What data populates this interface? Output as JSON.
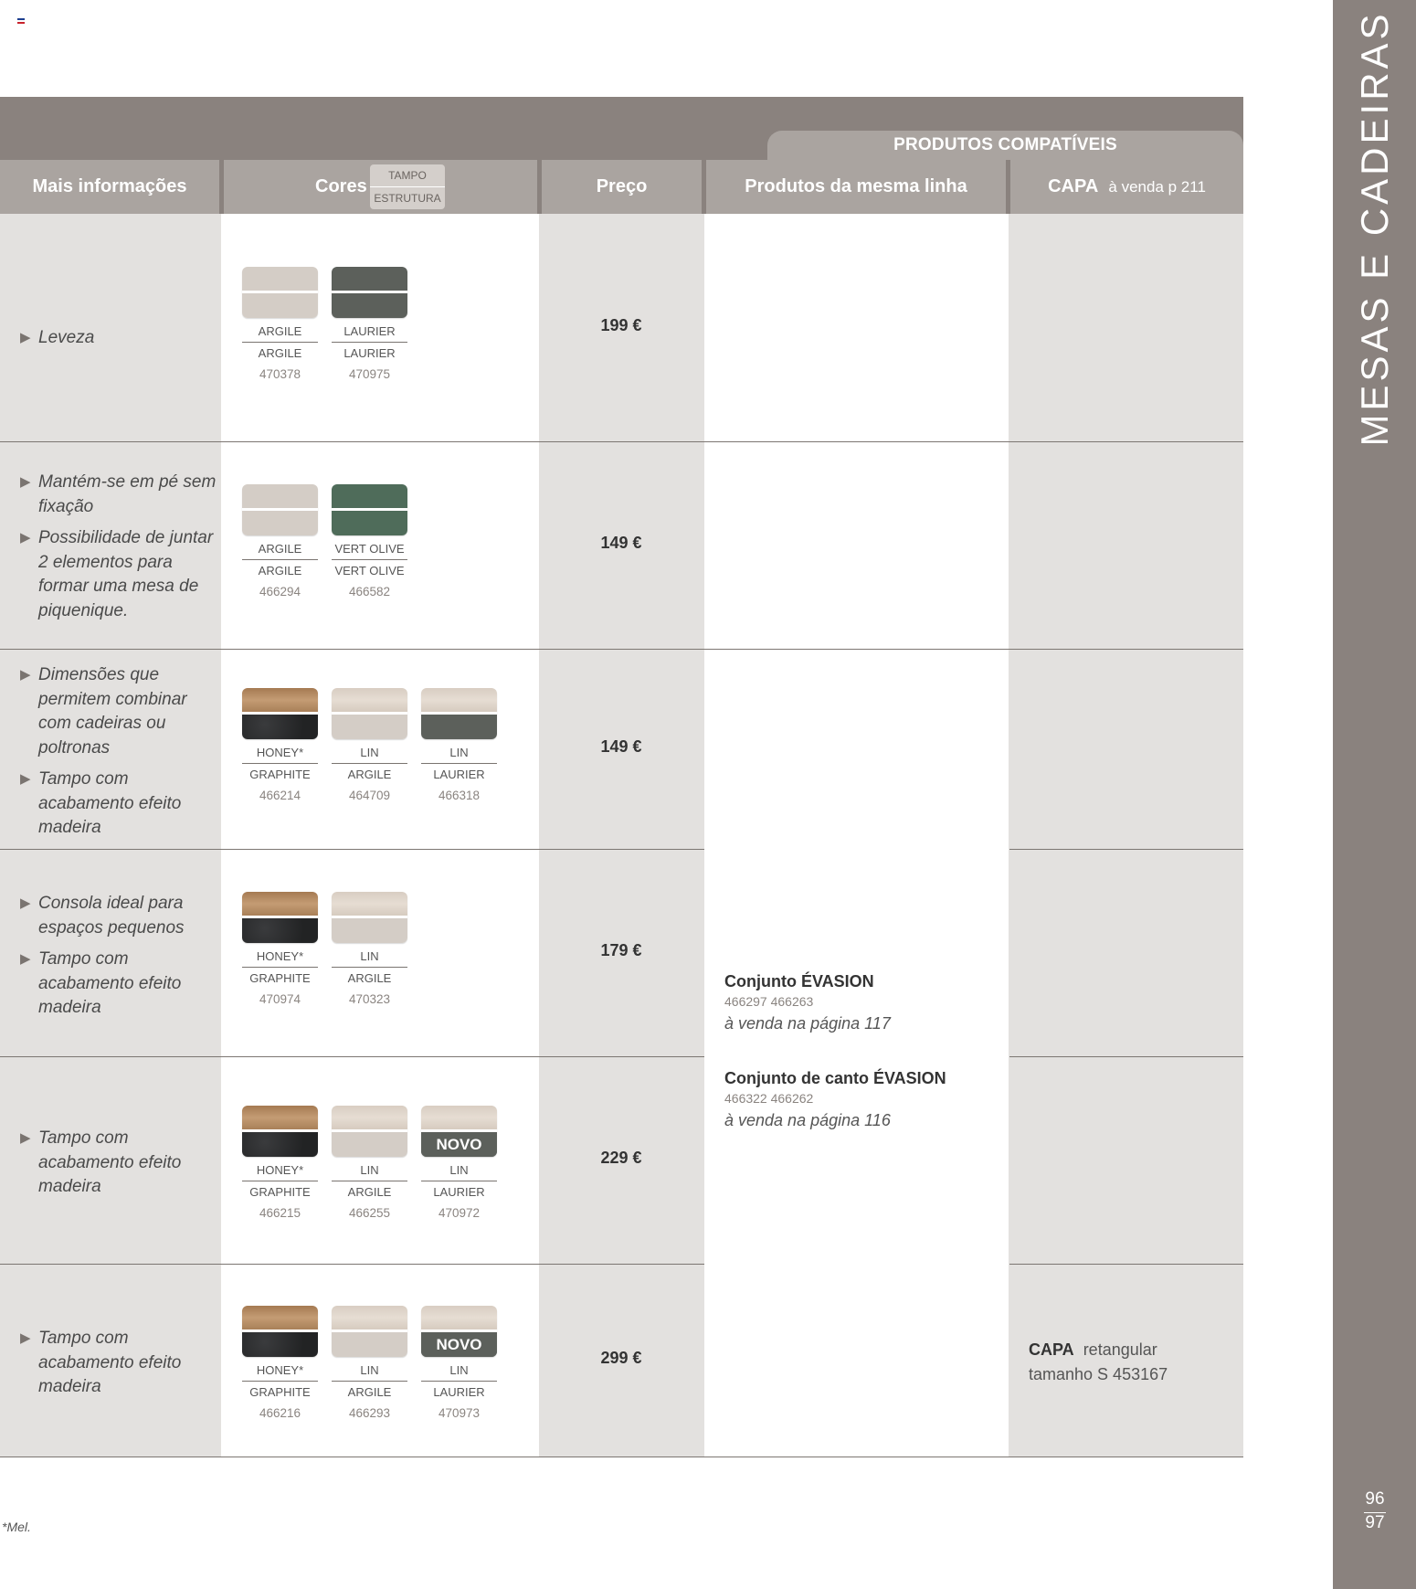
{
  "header": {
    "compat_title": "PRODUTOS COMPATÍVEIS",
    "col_info": "Mais informações",
    "col_cores": "Cores",
    "tampo": "TAMPO",
    "estrutura": "ESTRUTURA",
    "col_preco": "Preço",
    "col_mesma_linha": "Produtos  da mesma linha",
    "col_capa_bold": "CAPA",
    "col_capa_rest": "à venda p 211"
  },
  "colors": {
    "argile": "#d4cdc6",
    "laurier": "#5c605b",
    "vert_olive": "#4f6c5a",
    "honey": "#b3875f",
    "graphite": "#2d2e30",
    "lin": "#ddd3c9"
  },
  "rows": [
    {
      "info": [
        "Leveza"
      ],
      "price": "199 €",
      "swatches": [
        {
          "tampo": "ARGILE",
          "estrutura": "ARGILE",
          "ref": "470378",
          "top": "argile",
          "bottom": "argile",
          "novo": ""
        },
        {
          "tampo": "LAURIER",
          "estrutura": "LAURIER",
          "ref": "470975",
          "top": "laurier",
          "bottom": "laurier",
          "novo": ""
        }
      ]
    },
    {
      "info": [
        "Mantém-se em pé sem fixação",
        "Possibilidade de juntar 2 elementos para formar uma mesa de piquenique."
      ],
      "price": "149 €",
      "swatches": [
        {
          "tampo": "ARGILE",
          "estrutura": "ARGILE",
          "ref": "466294",
          "top": "argile",
          "bottom": "argile",
          "novo": ""
        },
        {
          "tampo": "VERT OLIVE",
          "estrutura": "VERT OLIVE",
          "ref": "466582",
          "top": "vert_olive",
          "bottom": "vert_olive",
          "novo": ""
        }
      ]
    },
    {
      "info": [
        "Dimensões que permitem combinar com cadeiras ou poltronas",
        "Tampo com acabamento efeito madeira"
      ],
      "price": "149 €",
      "swatches": [
        {
          "tampo": "HONEY*",
          "estrutura": "GRAPHITE",
          "ref": "466214",
          "top": "honey",
          "bottom": "graphite",
          "novo": ""
        },
        {
          "tampo": "LIN",
          "estrutura": "ARGILE",
          "ref": "464709",
          "top": "lin",
          "bottom": "argile",
          "novo": ""
        },
        {
          "tampo": "LIN",
          "estrutura": "LAURIER",
          "ref": "466318",
          "top": "lin",
          "bottom": "laurier",
          "novo": ""
        }
      ]
    },
    {
      "info": [
        "Consola ideal para espaços pequenos",
        "Tampo com acabamento efeito madeira"
      ],
      "price": "179 €",
      "swatches": [
        {
          "tampo": "HONEY*",
          "estrutura": "GRAPHITE",
          "ref": "470974",
          "top": "honey",
          "bottom": "graphite",
          "novo": ""
        },
        {
          "tampo": "LIN",
          "estrutura": "ARGILE",
          "ref": "470323",
          "top": "lin",
          "bottom": "argile",
          "novo": ""
        }
      ]
    },
    {
      "info": [
        "Tampo com acabamento efeito madeira"
      ],
      "price": "229 €",
      "swatches": [
        {
          "tampo": "HONEY*",
          "estrutura": "GRAPHITE",
          "ref": "466215",
          "top": "honey",
          "bottom": "graphite",
          "novo": ""
        },
        {
          "tampo": "LIN",
          "estrutura": "ARGILE",
          "ref": "466255",
          "top": "lin",
          "bottom": "argile",
          "novo": ""
        },
        {
          "tampo": "LIN",
          "estrutura": "LAURIER",
          "ref": "470972",
          "top": "lin",
          "bottom": "laurier",
          "novo": "NOVO"
        }
      ]
    },
    {
      "info": [
        "Tampo com acabamento efeito madeira"
      ],
      "price": "299 €",
      "swatches": [
        {
          "tampo": "HONEY*",
          "estrutura": "GRAPHITE",
          "ref": "466216",
          "top": "honey",
          "bottom": "graphite",
          "novo": ""
        },
        {
          "tampo": "LIN",
          "estrutura": "ARGILE",
          "ref": "466293",
          "top": "lin",
          "bottom": "argile",
          "novo": ""
        },
        {
          "tampo": "LIN",
          "estrutura": "LAURIER",
          "ref": "470973",
          "top": "lin",
          "bottom": "laurier",
          "novo": "NOVO"
        }
      ]
    }
  ],
  "related": [
    {
      "title": "Conjunto ÉVASION",
      "codes": "466297 466263",
      "page": "à venda na página 117"
    },
    {
      "title": "Conjunto de canto ÉVASION",
      "codes": "466322 466262",
      "page": "à venda na página 116"
    }
  ],
  "capa_note": {
    "bold": "CAPA",
    "line1": "retangular",
    "line2": "tamanho S 453167"
  },
  "footnote": "*Mel.",
  "sidebar": {
    "title": "MESAS E CADEIRAS",
    "page_top": "96",
    "page_bottom": "97"
  }
}
